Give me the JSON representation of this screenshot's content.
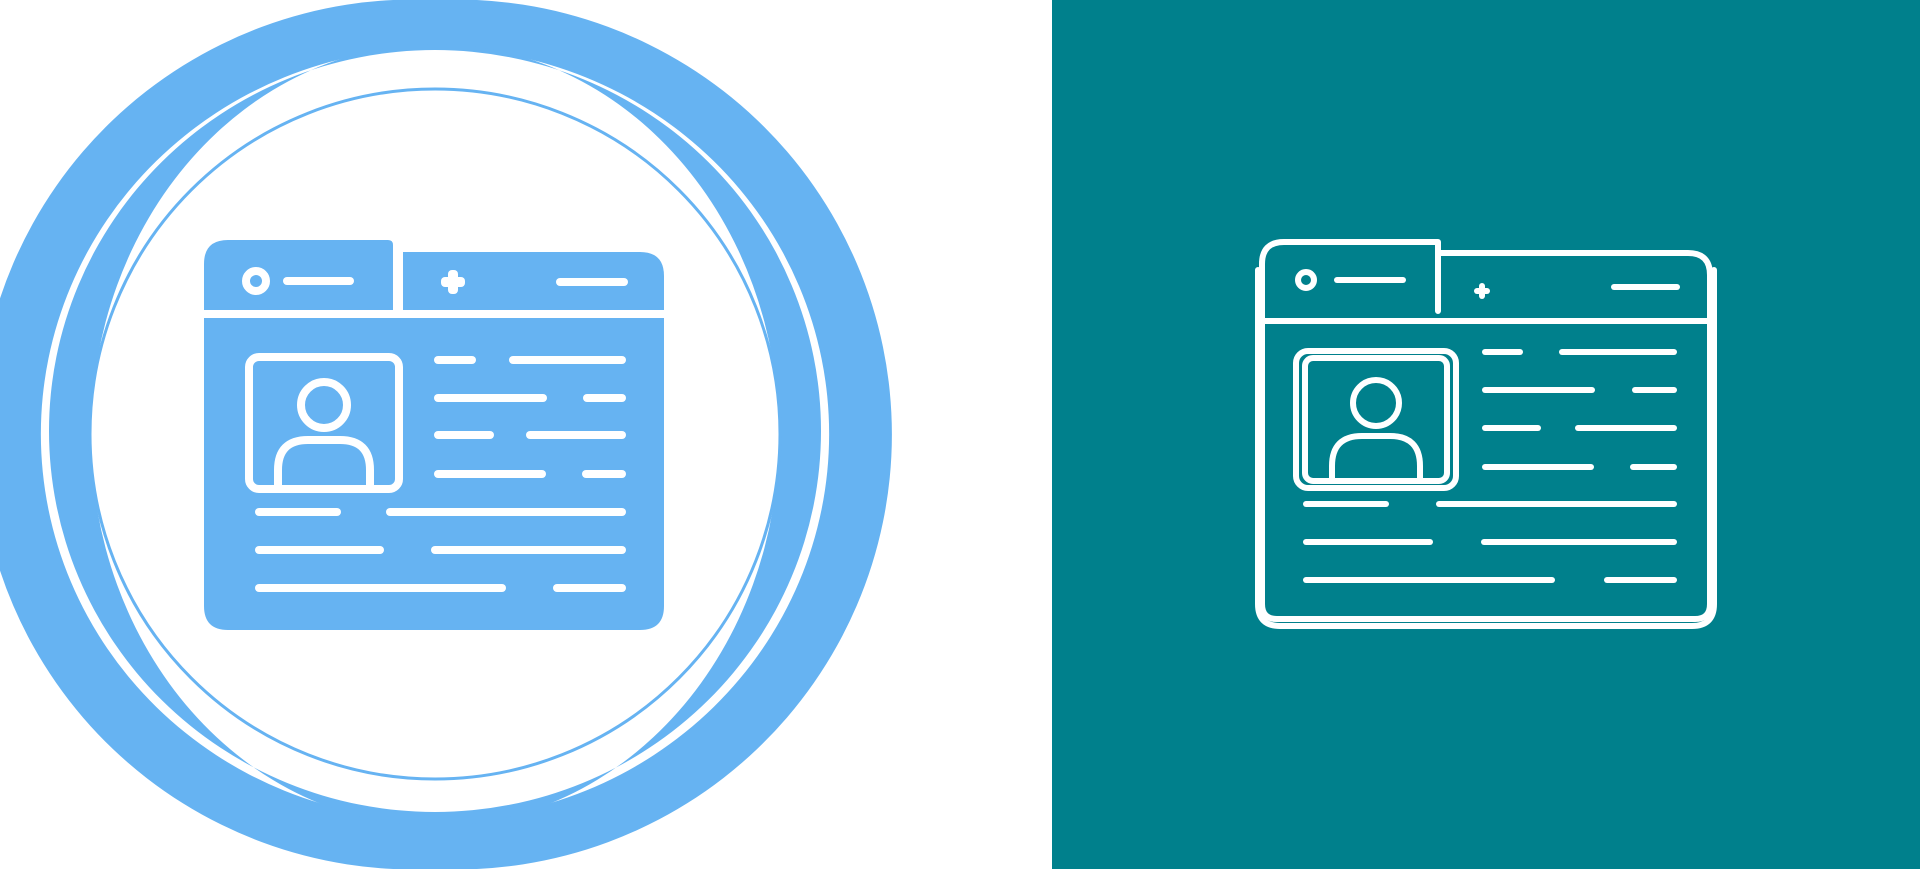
{
  "left": {
    "background": "#ffffff",
    "accent": "#66b3f2",
    "icon": "profile-browser-window-icon",
    "style": "glyph"
  },
  "right": {
    "background": "#00808c",
    "stroke": "#ffffff",
    "icon": "profile-browser-window-icon",
    "style": "line"
  }
}
